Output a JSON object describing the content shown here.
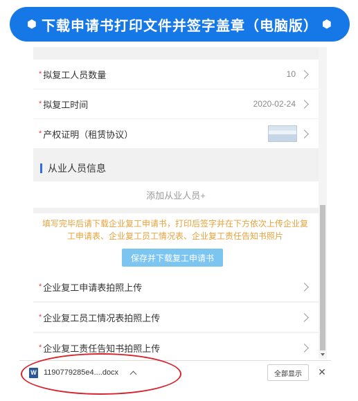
{
  "banner": {
    "title": "下载申请书打印文件并签字盖章（电脑版）",
    "deco": "⬢"
  },
  "form": {
    "rows_top": [
      {
        "label": "拟复工人员数量",
        "value": "10"
      },
      {
        "label": "拟复工时间",
        "value": "2020-02-24"
      },
      {
        "label": "产权证明（租赁协议）",
        "value": ""
      }
    ],
    "required_mark": "*",
    "section_title": "从业人员信息",
    "add_employee": "添加从业人员+",
    "notice": "填写完毕后请下载企业复工申请书，打印后签字并在下方依次上传企业复工申请表、企业复工员工情况表、企业复工责任告知书照片",
    "save_button": "保存并下载复工申请书",
    "uploads": [
      {
        "label": "企业复工申请表拍照上传"
      },
      {
        "label": "企业复工员工情况表拍照上传"
      },
      {
        "label": "企业复工责任告知书拍照上传"
      }
    ]
  },
  "download_bar": {
    "file_name": "1190779285e4....docx",
    "file_icon_letter": "W",
    "show_all": "全部显示",
    "close": "✕"
  }
}
